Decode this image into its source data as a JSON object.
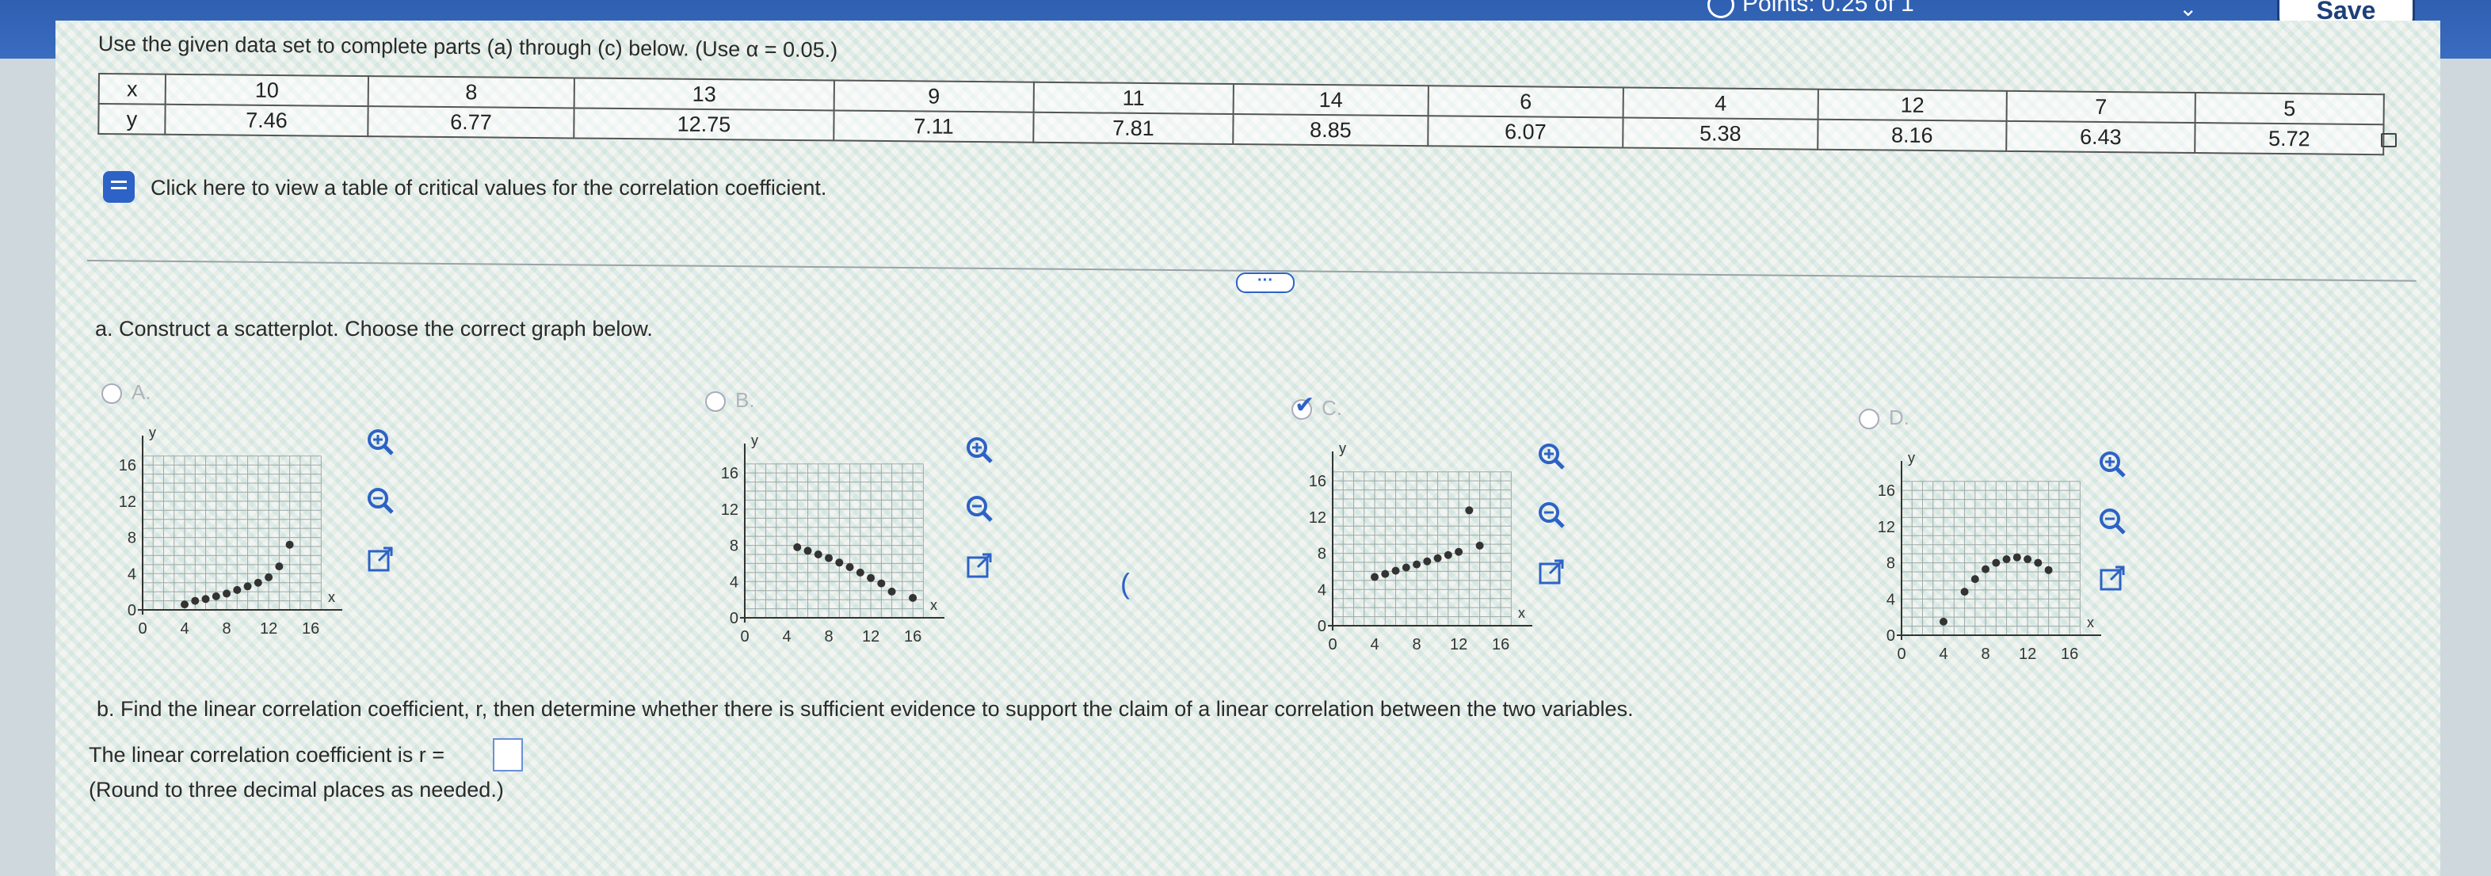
{
  "header": {
    "points": "Points: 0.25 of 1",
    "save_label": "Save"
  },
  "question": {
    "instruction": "Use the given data set to complete parts (a) through (c) below. (Use α = 0.05.)",
    "table": {
      "x_label": "x",
      "y_label": "y",
      "x": [
        "10",
        "8",
        "13",
        "9",
        "11",
        "14",
        "6",
        "4",
        "12",
        "7",
        "5"
      ],
      "y": [
        "7.46",
        "6.77",
        "12.75",
        "7.11",
        "7.81",
        "8.85",
        "6.07",
        "5.38",
        "8.16",
        "6.43",
        "5.72"
      ]
    },
    "critical_values_link": "Click here to view a table of critical values for the correlation coefficient."
  },
  "part_a": {
    "prompt": "a. Construct a scatterplot. Choose the correct graph below.",
    "options": [
      {
        "label": "A.",
        "selected": false
      },
      {
        "label": "B.",
        "selected": false
      },
      {
        "label": "C.",
        "selected": true
      },
      {
        "label": "D.",
        "selected": false
      }
    ]
  },
  "graph_axis": {
    "y_label": "y",
    "x_label": "x",
    "ticks_y": [
      "16",
      "12",
      "8",
      "4",
      "0"
    ],
    "ticks_x": [
      "0",
      "4",
      "8",
      "12",
      "16"
    ]
  },
  "graphs": [
    {
      "points": [
        [
          4,
          0.6
        ],
        [
          5,
          1.0
        ],
        [
          6,
          1.2
        ],
        [
          7,
          1.5
        ],
        [
          8,
          1.8
        ],
        [
          9,
          2.2
        ],
        [
          10,
          2.6
        ],
        [
          11,
          3.0
        ],
        [
          12,
          3.6
        ],
        [
          13,
          4.8
        ],
        [
          14,
          7.2
        ]
      ]
    },
    {
      "points": [
        [
          5,
          7.8
        ],
        [
          6,
          7.4
        ],
        [
          7,
          7.0
        ],
        [
          8,
          6.6
        ],
        [
          9,
          6.1
        ],
        [
          10,
          5.6
        ],
        [
          11,
          5.0
        ],
        [
          12,
          4.4
        ],
        [
          13,
          3.8
        ],
        [
          14,
          2.9
        ],
        [
          16,
          2.2
        ]
      ]
    },
    {
      "points": [
        [
          4,
          5.38
        ],
        [
          5,
          5.72
        ],
        [
          6,
          6.07
        ],
        [
          7,
          6.43
        ],
        [
          8,
          6.77
        ],
        [
          9,
          7.11
        ],
        [
          10,
          7.46
        ],
        [
          11,
          7.81
        ],
        [
          12,
          8.16
        ],
        [
          13,
          12.75
        ],
        [
          14,
          8.85
        ]
      ]
    },
    {
      "points": [
        [
          4,
          1.5
        ],
        [
          6,
          4.8
        ],
        [
          7,
          6.2
        ],
        [
          8,
          7.3
        ],
        [
          9,
          8.0
        ],
        [
          10,
          8.4
        ],
        [
          11,
          8.6
        ],
        [
          12,
          8.4
        ],
        [
          13,
          8.0
        ],
        [
          14,
          7.2
        ]
      ]
    }
  ],
  "tools": {
    "zoom_in": "zoom-in-icon",
    "zoom_out": "zoom-out-icon",
    "open": "external-link-icon"
  },
  "part_b": {
    "prompt": "b. Find the linear correlation coefficient, r, then determine whether there is sufficient evidence to support the claim of a linear correlation between the two variables.",
    "answer_prefix": "The linear correlation coefficient is r =",
    "answer_value": "",
    "round_note": "(Round to three decimal places as needed.)"
  }
}
